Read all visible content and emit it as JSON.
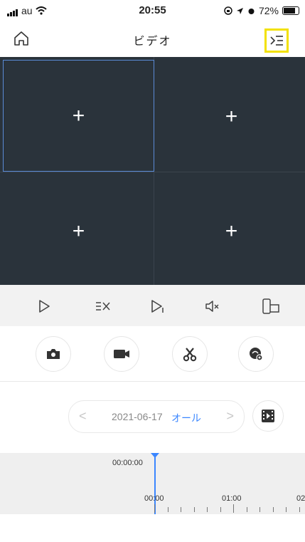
{
  "status_bar": {
    "carrier": "au",
    "time": "20:55",
    "battery": "72%",
    "battery_level": 0.72
  },
  "nav": {
    "title": "ビデオ",
    "home_icon": "home-icon",
    "list_icon": "list-select-icon",
    "highlight_color": "#f2e100"
  },
  "video_grid": {
    "cells": [
      "+",
      "+",
      "+",
      "+"
    ],
    "background": "#2a333b",
    "selected_border": "#5a8bd6"
  },
  "toolbar": {
    "icons": [
      "play-icon",
      "close-all-icon",
      "next-frame-icon",
      "mute-icon",
      "rotate-icon"
    ]
  },
  "actions": {
    "icons": [
      "camera-icon",
      "video-record-icon",
      "scissors-icon",
      "playback-eye-icon"
    ]
  },
  "date_bar": {
    "prev": "<",
    "date": "2021-06-17",
    "filter": "オール",
    "next": ">",
    "accent": "#3a86ff"
  },
  "timeline": {
    "current_time": "00:00:00",
    "labels": [
      "00:00",
      "01:00",
      "02"
    ]
  }
}
